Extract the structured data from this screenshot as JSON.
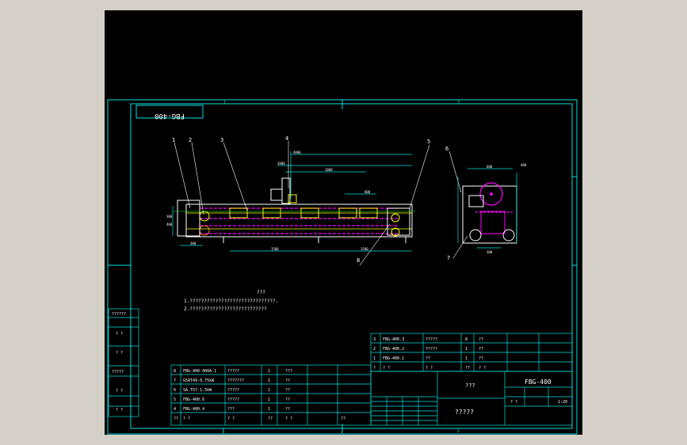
{
  "drawing": {
    "title_box": "FBG-400",
    "zone_top_1": "1",
    "zone_top_3": "3",
    "zone_bottom_2": "2"
  },
  "balloons": [
    "1",
    "2",
    "3",
    "4",
    "5",
    "6",
    "7",
    "8"
  ],
  "dimensions": {
    "top_overall": "4000",
    "top_inner": "3800",
    "top_mid": "1800",
    "top_short": "800",
    "left_h1": "300",
    "left_h2": "400",
    "bottom_left": "300",
    "bottom_mid_1": "1500",
    "bottom_mid_2": "1500",
    "side_width": "600",
    "side_dim_r": "400",
    "side_bottom": "300"
  },
  "notes": {
    "heading": "???",
    "line1": "1.??????????????????????????????.",
    "line2": "2.???????????????????????????"
  },
  "parts_list_upper": [
    [
      "3",
      "FBG-400.3",
      "?????",
      "8",
      "??",
      ""
    ],
    [
      "2",
      "FBG-400.2",
      "?????",
      "1",
      "??",
      ""
    ],
    [
      "1",
      "FBG-400.1",
      "??",
      "1",
      "??",
      ""
    ],
    [
      "?",
      "? ?",
      "? ?",
      "??",
      "? ?",
      ""
    ]
  ],
  "parts_list_lower": [
    [
      "8",
      "FBG-400-400A.1",
      "?????",
      "1",
      "???",
      ""
    ],
    [
      "7",
      "G5AT49-0.75kW",
      "???????",
      "1",
      "??",
      ""
    ],
    [
      "6",
      "SA.T57-1.5kW",
      "?????",
      "1",
      "??",
      ""
    ],
    [
      "5",
      "FBG-400.6",
      "?????",
      "1",
      "??",
      ""
    ],
    [
      "4",
      "FBG-400.4",
      "???",
      "1",
      "??",
      ""
    ],
    [
      "??",
      "? ?",
      "? ?",
      "??",
      "? ?",
      "??"
    ]
  ],
  "left_strip": [
    "??????",
    "? ?",
    "? ?",
    "?????",
    "? ?",
    "? ?"
  ],
  "title_block": {
    "company": "???",
    "drawing_no": "FBG-400",
    "name": "?????",
    "scale": "1:20",
    "sheet": "? ?"
  }
}
